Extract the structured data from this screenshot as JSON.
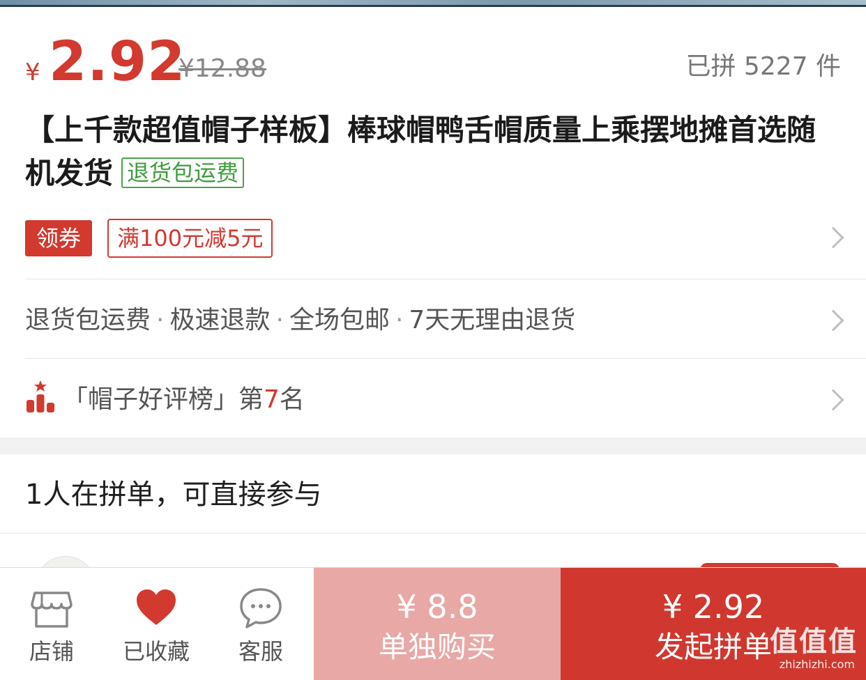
{
  "product": {
    "price_symbol": "¥",
    "price": "2.92",
    "original_price": "¥12.88",
    "sold_count": "已拼 5227 件",
    "title": "【上千款超值帽子样板】棒球帽鸭舌帽质量上乘摆地摊首选随机发货",
    "returns_tag": "退货包运费"
  },
  "coupon": {
    "button_label": "领券",
    "offer": "满100元减5元"
  },
  "services": [
    "退货包运费",
    "极速退款",
    "全场包邮",
    "7天无理由退货"
  ],
  "service_separator": "·",
  "ranking": {
    "prefix": "「帽子好评榜」第",
    "number": "7",
    "suffix": "名"
  },
  "group_buy": {
    "heading": "1人在拼单，可直接参与"
  },
  "bottom_bar": {
    "store_label": "店铺",
    "favorite_label": "已收藏",
    "service_label": "客服",
    "solo_price": "¥ 8.8",
    "solo_label": "单独购买",
    "group_price": "¥ 2.92",
    "group_label": "发起拼单"
  },
  "watermark": {
    "main": "值值值",
    "sub": "zhizhizhi.com"
  },
  "colors": {
    "accent_red": "#d2392f",
    "soft_red": "#e8a8a6",
    "green_tag": "#3e9c3e"
  }
}
